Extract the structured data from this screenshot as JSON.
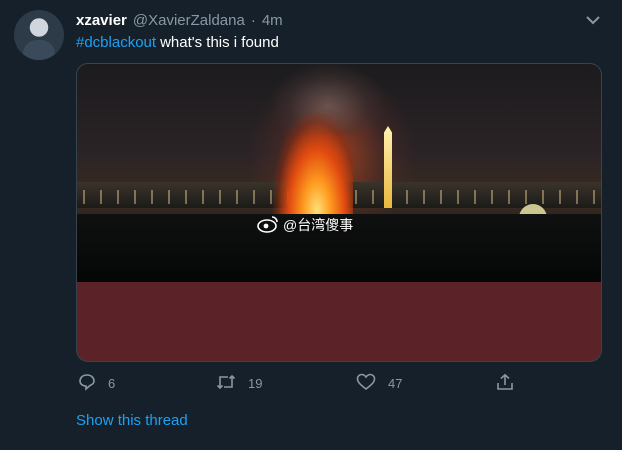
{
  "tweet": {
    "display_name": "xzavier",
    "handle": "@XavierZaldana",
    "separator": "·",
    "time": "4m",
    "hashtag": "#dcblackout",
    "text": "what's this i found"
  },
  "media": {
    "watermark": "@台湾傻事",
    "watermark_icon": "weibo-logo"
  },
  "actions": {
    "reply_count": "6",
    "retweet_count": "19",
    "like_count": "47"
  },
  "show_thread": "Show this thread",
  "colors": {
    "background": "#15202b",
    "accent": "#1da1f2",
    "secondary_text": "#8899a6",
    "media_fill": "#5b2227"
  }
}
